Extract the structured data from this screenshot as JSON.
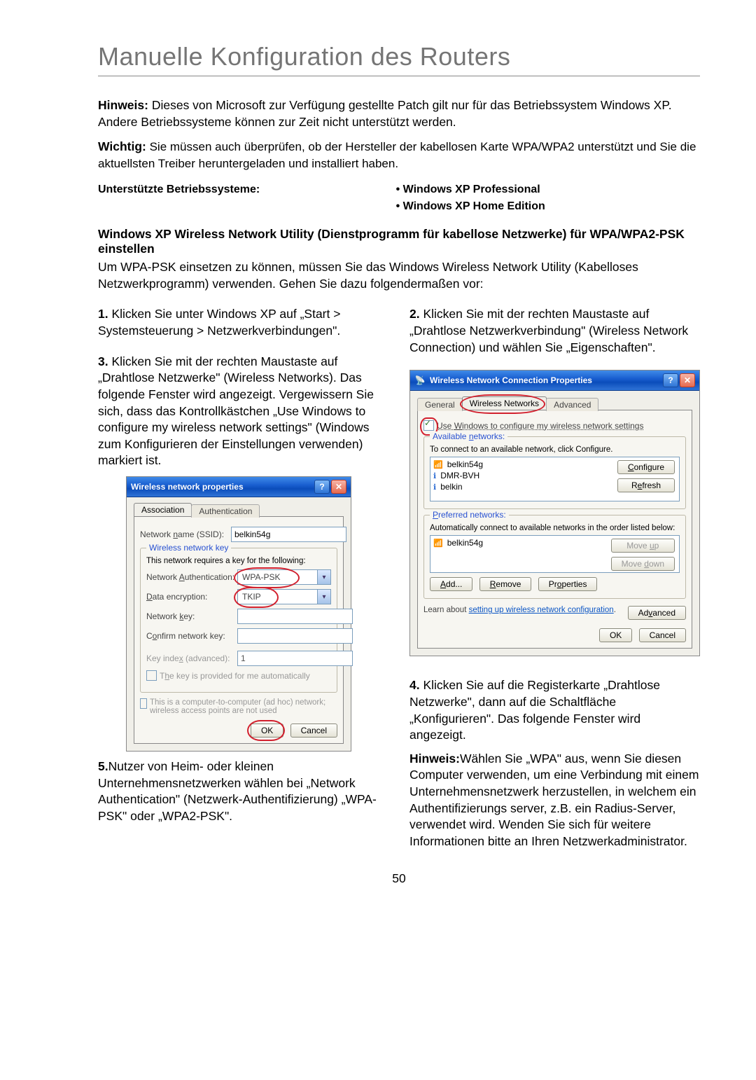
{
  "page": {
    "title": "Manuelle Konfiguration des Routers",
    "hinweis_label": "Hinweis:",
    "hinweis_text": " Dieses von Microsoft zur Verfügung gestellte Patch gilt nur für das Betriebssystem Windows XP. Andere Betriebssysteme können zur Zeit nicht unterstützt werden.",
    "wichtig_label": "Wichtig:",
    "wichtig_text": " Sie müssen auch überprüfen, ob der Hersteller der kabellosen Karte WPA/WPA2 unterstützt und Sie die aktuellsten Treiber heruntergeladen und installiert haben.",
    "os_heading": "Unterstützte Betriebssysteme:",
    "os_bullet1": "• Windows XP Professional",
    "os_bullet2": "• Windows XP Home Edition",
    "section_title": "Windows XP Wireless Network Utility (Dienstprogramm für kabellose Netzwerke) für WPA/WPA2-PSK einstellen",
    "intro2": "Um WPA-PSK einsetzen zu können, müssen Sie das Windows Wireless Network Utility (Kabelloses Netzwerkprogramm) verwenden. Gehen Sie dazu folgendermaßen vor:",
    "step1_num": "1.",
    "step1_text": " Klicken Sie unter Windows XP auf „Start > Systemsteuerung > Netzwerkverbindungen\".",
    "step2_num": "2.",
    "step2_text": " Klicken Sie mit der rechten Maustaste auf „Drahtlose Netzwerkverbindung\" (Wireless Network Connection) und wählen Sie „Eigenschaften\".",
    "step3_num": "3.",
    "step3_text": "  Klicken Sie mit der rechten Maustaste auf „Drahtlose Netzwerke\" (Wireless Networks). Das folgende Fenster wird angezeigt. Vergewissern Sie sich, dass das Kontrollkästchen „Use Windows to configure my wireless network settings\" (Windows zum Konfigurieren der Einstellungen verwenden) markiert ist.",
    "step4_num": "4.",
    "step4_text": "  Klicken Sie auf die Registerkarte „Drahtlose Netzwerke\", dann auf die Schaltfläche „Konfigurieren\". Das folgende Fenster wird angezeigt.",
    "step4_hinweis_label": "Hinweis:",
    "step4_hinweis_text": "Wählen Sie „WPA\" aus, wenn Sie diesen Computer verwenden, um eine Verbindung mit einem Unternehmensnetzwerk herzustellen, in welchem ein Authentifizierungs server, z.B. ein Radius-Server, verwendet wird. Wenden Sie sich für weitere Informationen bitte an Ihren Netzwerkadministrator.",
    "step5_num": "5.",
    "step5_text": "Nutzer von Heim- oder kleinen Unternehmensnetzwerken wählen bei „Network Authentication\" (Netzwerk-Authentifizierung) „WPA-PSK\" oder „WPA2-PSK\".",
    "footer_page": "50"
  },
  "dlg1": {
    "title": "Wireless network properties",
    "tab_assoc": "Association",
    "tab_auth": "Authentication",
    "ssid_label": "Network name (SSID):",
    "ssid_value": "belkin54g",
    "wkey_title": "Wireless network key",
    "wkey_desc": "This network requires a key for the following:",
    "auth_label": "Network Authentication:",
    "auth_value": "WPA-PSK",
    "enc_label": "Data encryption:",
    "enc_value": "TKIP",
    "netkey_label": "Network key:",
    "confirm_label": "Confirm network key:",
    "keyidx_label": "Key index (advanced):",
    "keyidx_value": "1",
    "autokey": "The key is provided for me automatically",
    "adhoc": "This is a computer-to-computer (ad hoc) network; wireless access points are not used",
    "ok": "OK",
    "cancel": "Cancel"
  },
  "dlg2": {
    "title": "Wireless Network Connection Properties",
    "tab_general": "General",
    "tab_wireless": "Wireless Networks",
    "tab_advanced": "Advanced",
    "use_windows": "Use Windows to configure my wireless network settings",
    "avail_title": "Available networks:",
    "avail_desc": "To connect to an available network, click Configure.",
    "avail_items": [
      "belkin54g",
      "DMR-BVH",
      "belkin"
    ],
    "configure": "Configure",
    "refresh": "Refresh",
    "pref_title": "Preferred networks:",
    "pref_desc": "Automatically connect to available networks in the order listed below:",
    "pref_items": [
      "belkin54g"
    ],
    "moveup": "Move up",
    "movedown": "Move down",
    "add": "Add...",
    "remove": "Remove",
    "properties": "Properties",
    "learn": "Learn about ",
    "learn_link": "setting up wireless network configuration",
    "learn_end": ".",
    "advanced_btn": "Advanced",
    "ok": "OK",
    "cancel": "Cancel"
  }
}
